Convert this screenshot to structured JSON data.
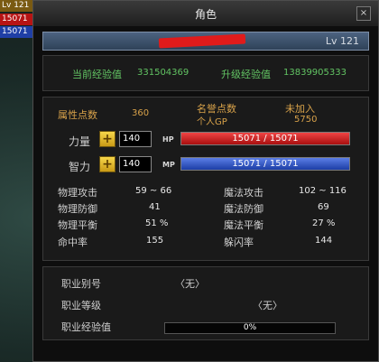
{
  "background": {
    "bar1": "Lv 121",
    "bar2": "15071",
    "bar3": "15071"
  },
  "window": {
    "title": "角色",
    "close_label": "×"
  },
  "character": {
    "level": "Lv 121"
  },
  "experience": {
    "current_label": "当前经验值",
    "current_value": "331504369",
    "next_label": "升级经验值",
    "next_value": "13839905333"
  },
  "attributes": {
    "points_label": "属性点数",
    "points_value": "360",
    "fame_label": "名誉点数",
    "fame_value": "未加入",
    "gp_label": "个人GP",
    "gp_value": "5750",
    "strength_label": "力量",
    "strength_value": "140",
    "intellect_label": "智力",
    "intellect_value": "140",
    "hp_tag": "HP",
    "mp_tag": "MP",
    "hp_text": "15071 / 15071",
    "mp_text": "15071 / 15071",
    "hp_fraction": 1.0,
    "mp_fraction": 1.0
  },
  "stats": {
    "phys_atk_label": "物理攻击",
    "phys_atk_value": "59 ~ 66",
    "mag_atk_label": "魔法攻击",
    "mag_atk_value": "102 ~ 116",
    "phys_def_label": "物理防御",
    "phys_def_value": "41",
    "mag_def_label": "魔法防御",
    "mag_def_value": "69",
    "phys_bal_label": "物理平衡",
    "phys_bal_value": "51 %",
    "mag_bal_label": "魔法平衡",
    "mag_bal_value": "27 %",
    "hit_label": "命中率",
    "hit_value": "155",
    "dodge_label": "躲闪率",
    "dodge_value": "144"
  },
  "job": {
    "id_label": "职业别号",
    "id_value": "〈无〉",
    "level_label": "职业等级",
    "level_value": "〈无〉",
    "exp_label": "职业经验值",
    "exp_text": "0%",
    "exp_fraction": 0
  },
  "colors": {
    "hp": "#c81a1a",
    "mp": "#2f52c8",
    "green_text": "#62c463",
    "orange_text": "#d8a24a"
  }
}
